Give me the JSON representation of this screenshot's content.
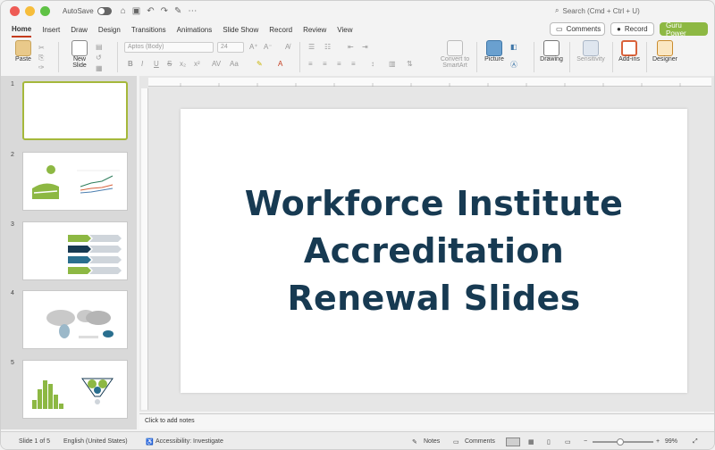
{
  "titlebar": {
    "autosave_label": "AutoSave",
    "search_placeholder": "Search (Cmd + Ctrl + U)"
  },
  "tabs": [
    "Home",
    "Insert",
    "Draw",
    "Design",
    "Transitions",
    "Animations",
    "Slide Show",
    "Record",
    "Review",
    "View"
  ],
  "right_buttons": {
    "comments": "Comments",
    "record": "Record",
    "guru": "Guru Power"
  },
  "ribbon": {
    "paste": "Paste",
    "new_slide_1": "New",
    "new_slide_2": "Slide",
    "font_name": "Aptos (Body)",
    "font_size": "24",
    "convert_1": "Convert to",
    "convert_2": "SmartArt",
    "picture": "Picture",
    "drawing": "Drawing",
    "sensitivity": "Sensitivity",
    "addins": "Add-ins",
    "designer": "Designer"
  },
  "slides": [
    "1",
    "2",
    "3",
    "4",
    "5"
  ],
  "slide": {
    "title_line1": "Workforce Institute",
    "title_line2": "Accreditation",
    "title_line3": "Renewal Slides"
  },
  "notes_placeholder": "Click to add notes",
  "status": {
    "slide_count": "Slide 1 of 5",
    "language": "English (United States)",
    "accessibility": "Accessibility: Investigate",
    "notes": "Notes",
    "comments": "Comments",
    "zoom": "99%"
  },
  "colors": {
    "accent": "#c43b1d",
    "title": "#173a52",
    "guru": "#8db843"
  }
}
